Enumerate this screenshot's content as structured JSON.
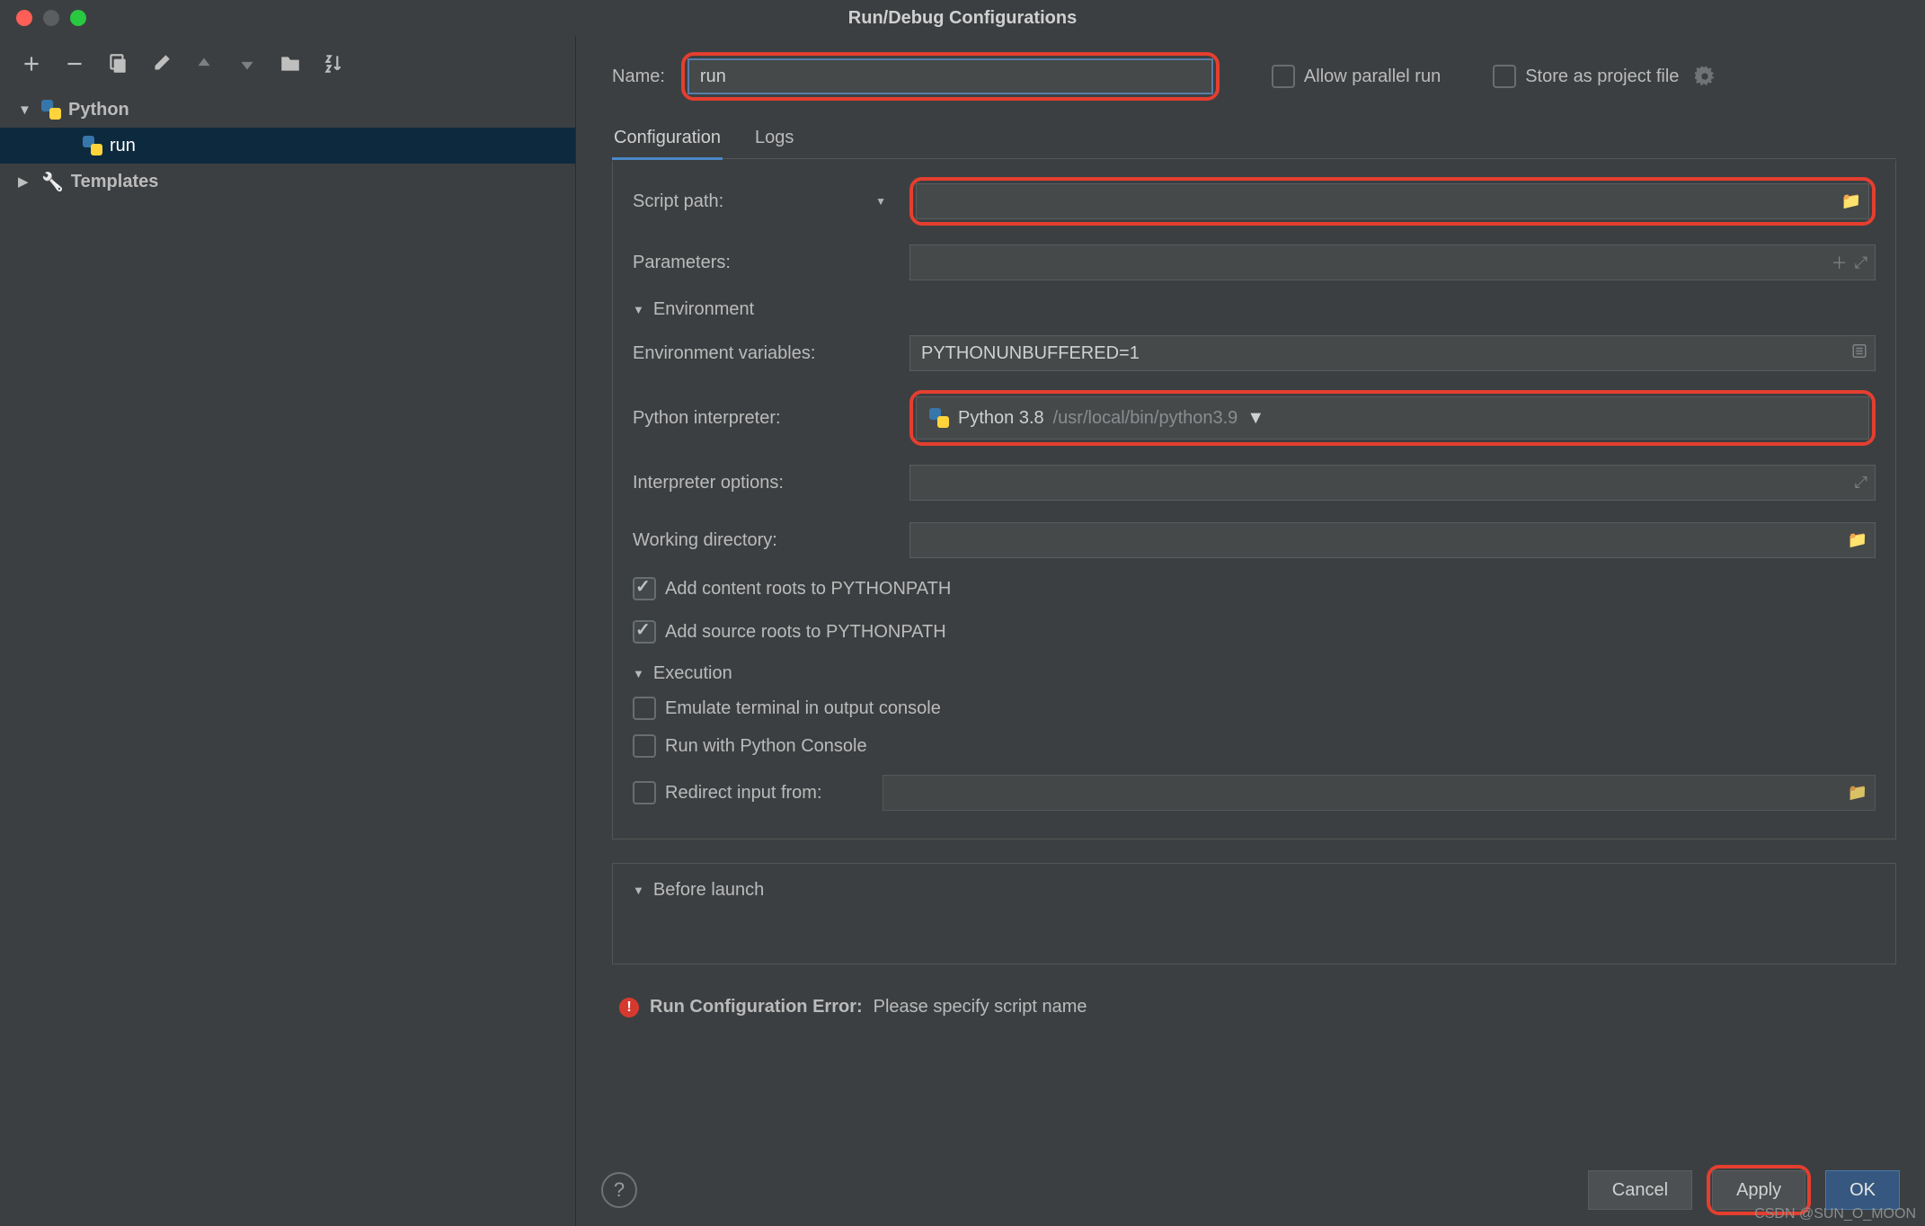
{
  "window": {
    "title": "Run/Debug Configurations"
  },
  "sidebar": {
    "tree": {
      "python_label": "Python",
      "run_item": "run",
      "templates_label": "Templates"
    }
  },
  "form": {
    "name_label": "Name:",
    "name_value": "run",
    "allow_parallel": "Allow parallel run",
    "store_project": "Store as project file",
    "tabs": {
      "configuration": "Configuration",
      "logs": "Logs"
    },
    "script_path_label": "Script path:",
    "script_path_value": "",
    "parameters_label": "Parameters:",
    "parameters_value": "",
    "environment_section": "Environment",
    "env_vars_label": "Environment variables:",
    "env_vars_value": "PYTHONUNBUFFERED=1",
    "interpreter_label": "Python interpreter:",
    "interpreter_name": "Python 3.8",
    "interpreter_path": "/usr/local/bin/python3.9",
    "interp_opts_label": "Interpreter options:",
    "interp_opts_value": "",
    "workdir_label": "Working directory:",
    "workdir_value": "",
    "add_content_roots": "Add content roots to PYTHONPATH",
    "add_source_roots": "Add source roots to PYTHONPATH",
    "execution_section": "Execution",
    "emulate_terminal": "Emulate terminal in output console",
    "run_python_console": "Run with Python Console",
    "redirect_input_label": "Redirect input from:",
    "redirect_input_value": "",
    "before_launch_section": "Before launch"
  },
  "error": {
    "title": "Run Configuration Error:",
    "message": "Please specify script name"
  },
  "buttons": {
    "cancel": "Cancel",
    "apply": "Apply",
    "ok": "OK"
  },
  "watermark": "CSDN @SUN_O_MOON"
}
